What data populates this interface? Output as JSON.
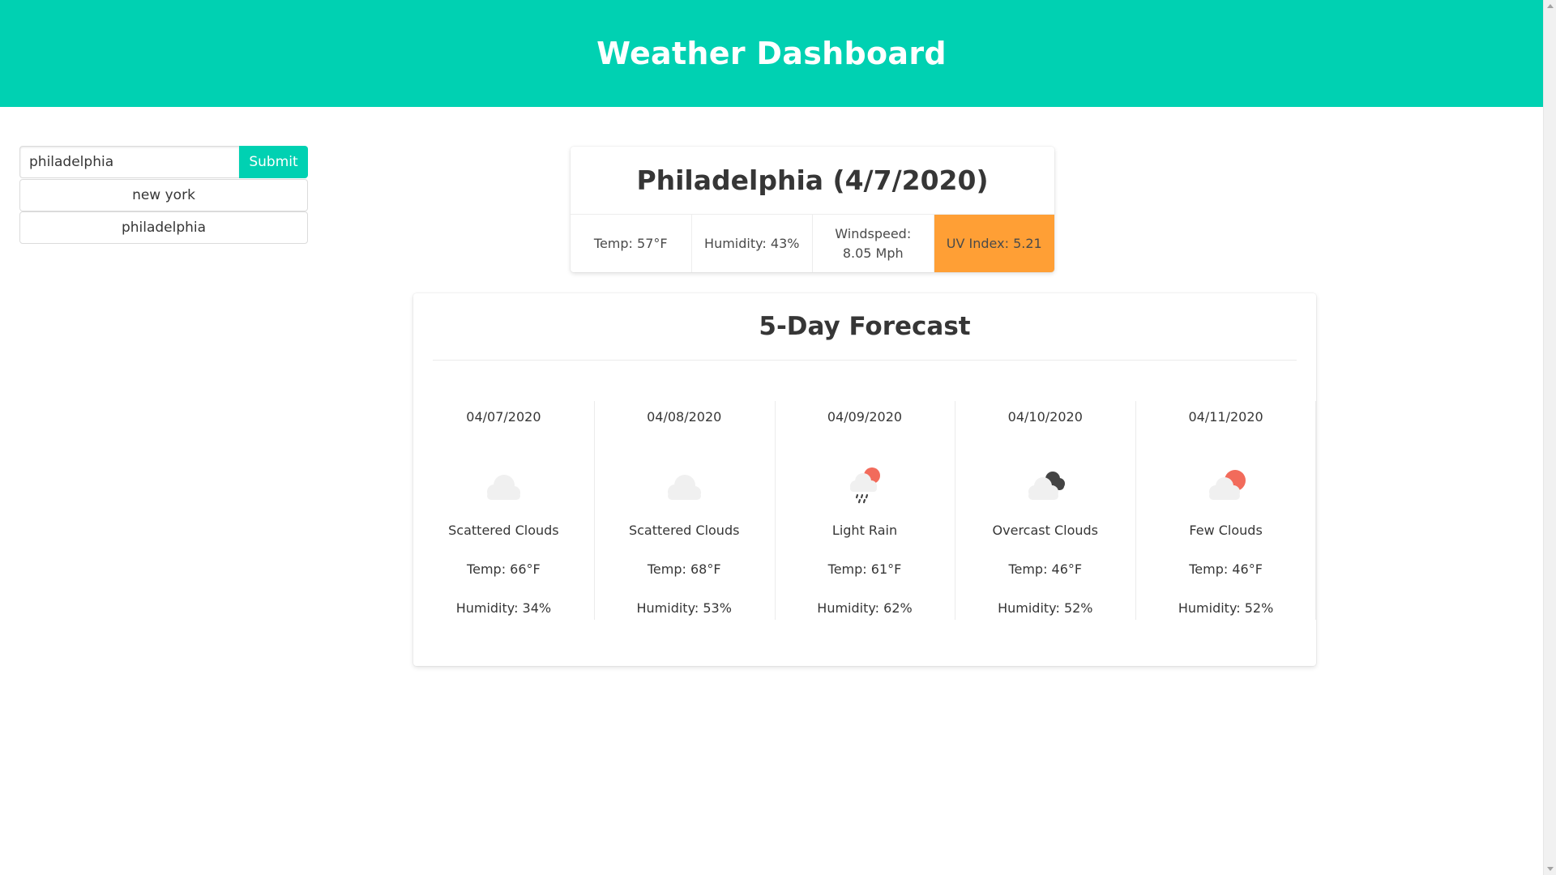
{
  "header": {
    "title": "Weather Dashboard"
  },
  "search": {
    "value": "philadelphia",
    "submit_label": "Submit"
  },
  "history": [
    {
      "label": "new york"
    },
    {
      "label": "philadelphia"
    }
  ],
  "current": {
    "title": "Philadelphia (4/7/2020)",
    "temp": "Temp: 57°F",
    "humidity": "Humidity: 43%",
    "windspeed": "Windspeed: 8.05 Mph",
    "uv": "UV Index: 5.21",
    "uv_color": "#ff9f35"
  },
  "forecast": {
    "title": "5-Day Forecast",
    "days": [
      {
        "date": "04/07/2020",
        "icon": "scattered-clouds-icon",
        "desc": "Scattered Clouds",
        "temp": "Temp: 66°F",
        "humidity": "Humidity: 34%"
      },
      {
        "date": "04/08/2020",
        "icon": "scattered-clouds-icon",
        "desc": "Scattered Clouds",
        "temp": "Temp: 68°F",
        "humidity": "Humidity: 53%"
      },
      {
        "date": "04/09/2020",
        "icon": "light-rain-icon",
        "desc": "Light Rain",
        "temp": "Temp: 61°F",
        "humidity": "Humidity: 62%"
      },
      {
        "date": "04/10/2020",
        "icon": "overcast-clouds-icon",
        "desc": "Overcast Clouds",
        "temp": "Temp: 46°F",
        "humidity": "Humidity: 52%"
      },
      {
        "date": "04/11/2020",
        "icon": "few-clouds-icon",
        "desc": "Few Clouds",
        "temp": "Temp: 46°F",
        "humidity": "Humidity: 52%"
      }
    ]
  },
  "colors": {
    "accent": "#00d1b2",
    "sun": "#f26b5b",
    "dark_cloud": "#444444",
    "light_cloud": "#f0f0f0"
  }
}
